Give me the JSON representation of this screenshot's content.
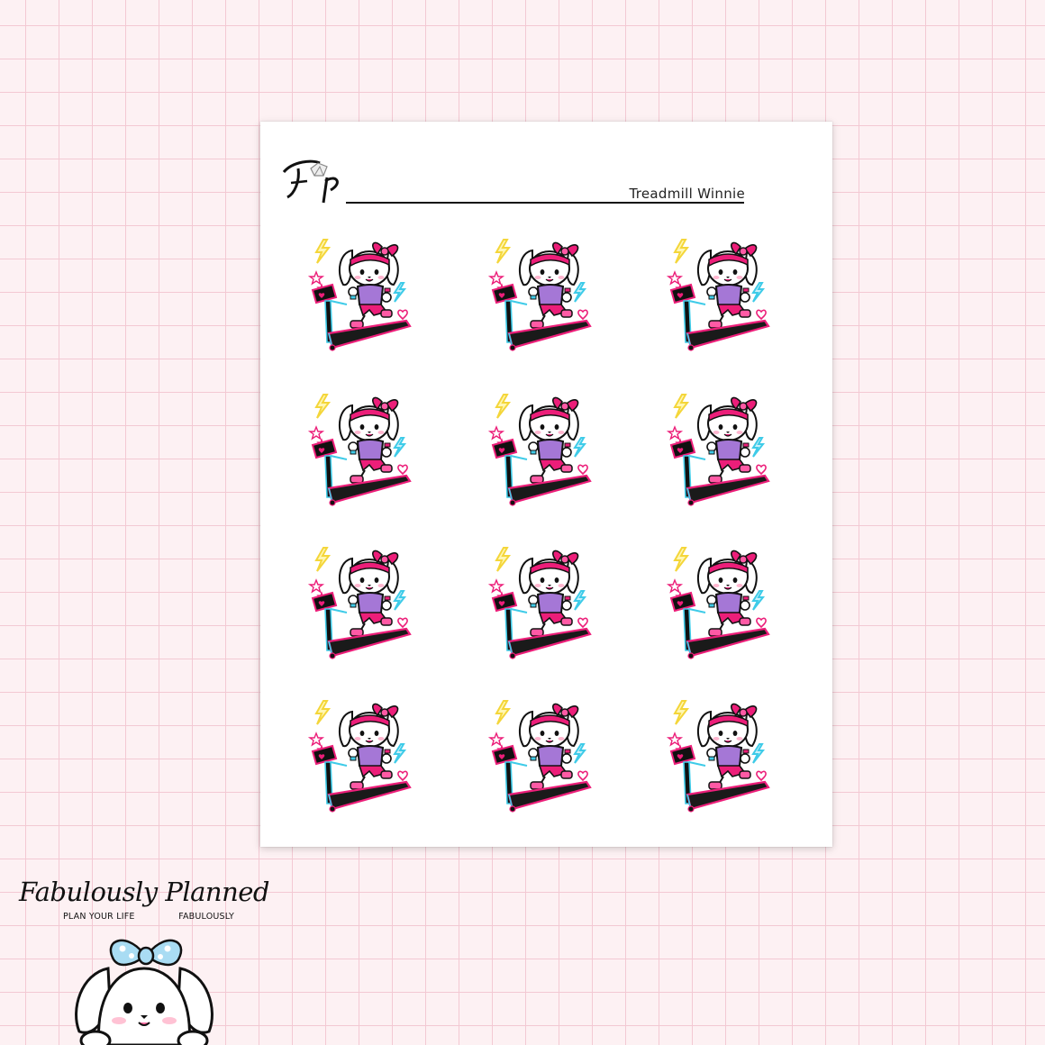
{
  "sheet": {
    "logo_text": "Fp",
    "title": "Treadmill Winnie",
    "sticker_count": 12
  },
  "brand": {
    "name": "Fabulously Planned",
    "tagline_left": "PLAN YOUR LIFE",
    "tagline_right": "FABULOUSLY"
  },
  "colors": {
    "background": "#fdf1f3",
    "grid": "#f3c9d3",
    "pink": "#ec1e79",
    "cyan": "#3ecbe8",
    "yellow": "#f4d63a",
    "purple": "#a577d6",
    "bow_blue": "#a9dcf3"
  }
}
